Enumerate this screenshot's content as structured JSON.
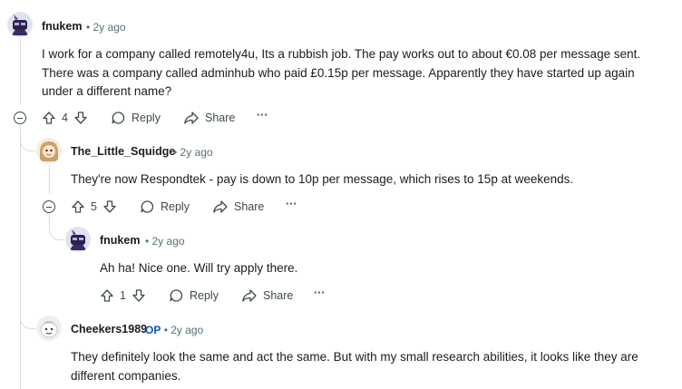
{
  "comments": [
    {
      "author": "fnukem",
      "time": "2y ago",
      "body": "I work for a company called remotely4u, Its a rubbish job. The pay works out to about €0.08 per message sent. There was a company called adminhub who paid £0.15p per message. Apparently they have started up again under a different name?",
      "votes": "4",
      "reply_label": "Reply",
      "share_label": "Share",
      "more_label": "···"
    },
    {
      "author": "The_Little_Squidge",
      "time": "2y ago",
      "body": "They're now Respondtek - pay is down to 10p per message, which rises to 15p at weekends.",
      "votes": "5",
      "reply_label": "Reply",
      "share_label": "Share",
      "more_label": "···"
    },
    {
      "author": "fnukem",
      "time": "2y ago",
      "body": "Ah ha! Nice one. Will try apply there.",
      "votes": "1",
      "reply_label": "Reply",
      "share_label": "Share",
      "more_label": "···"
    },
    {
      "author": "Cheekers1989",
      "op_badge": "OP",
      "time": "2y ago",
      "body": "They definitely look the same and act the same. But with my small research abilities, it looks like they are different companies."
    }
  ],
  "separator": "•",
  "icons": {
    "upvote": "arrow-up-icon",
    "downvote": "arrow-down-icon",
    "reply": "speech-bubble-icon",
    "share": "share-arrow-icon",
    "collapse": "minus-circle-icon"
  },
  "colors": {
    "meta": "#576f76",
    "op": "#0a56c2",
    "line": "#d9dde0"
  }
}
